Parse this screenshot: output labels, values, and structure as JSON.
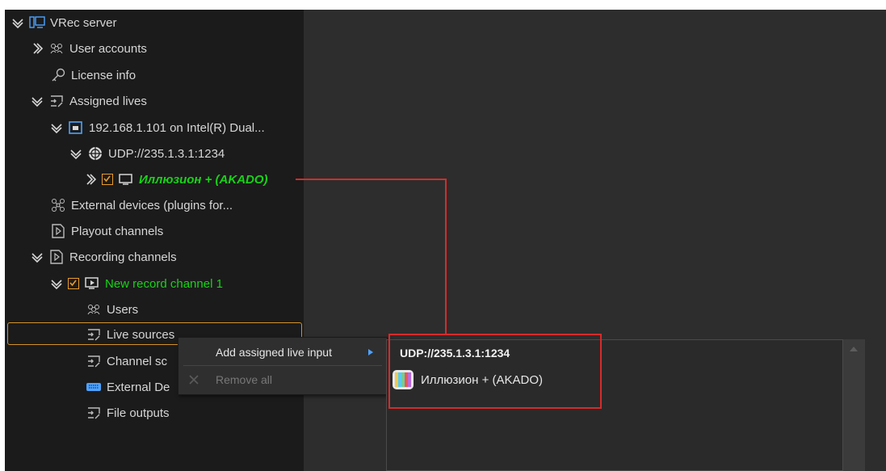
{
  "tree": {
    "root": {
      "label": "VRec server"
    },
    "user_accounts": {
      "label": "User accounts"
    },
    "license_info": {
      "label": "License info"
    },
    "assigned_lives": {
      "label": "Assigned lives"
    },
    "ip_node": {
      "label": "192.168.1.101 on Intel(R) Dual..."
    },
    "udp_node": {
      "label": "UDP://235.1.3.1:1234"
    },
    "channel_node": {
      "label": "Иллюзион + (AKADO)"
    },
    "external_devices": {
      "label": "External devices (plugins for..."
    },
    "playout_channels": {
      "label": "Playout channels"
    },
    "recording_channels": {
      "label": "Recording channels"
    },
    "new_record_channel": {
      "label": "New record channel 1"
    },
    "users": {
      "label": "Users"
    },
    "live_sources": {
      "label": "Live sources"
    },
    "channel_sc": {
      "label": "Channel sc"
    },
    "external_de": {
      "label": "External De"
    },
    "file_outputs": {
      "label": "File outputs"
    }
  },
  "context_menu": {
    "add_assigned": "Add assigned live input",
    "remove_all": "Remove all"
  },
  "submenu": {
    "header": "UDP://235.1.3.1:1234",
    "item": "Иллюзион + (AKADO)"
  },
  "colors": {
    "tree_bg": "#1b1b1b",
    "panel_bg": "#2d2d2d",
    "accent_green": "#19d219",
    "check_orange": "#e89b2c",
    "highlight_red": "#d62b2b"
  }
}
